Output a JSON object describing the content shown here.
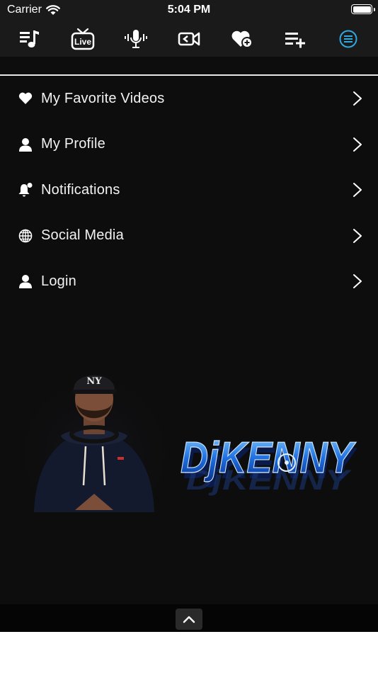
{
  "status_bar": {
    "carrier": "Carrier",
    "time": "5:04 PM",
    "battery_level": 1.0
  },
  "toolbar": {
    "items": [
      {
        "icon": "music-playlist-icon",
        "label": ""
      },
      {
        "icon": "live-tv-icon",
        "label": "Live"
      },
      {
        "icon": "podcast-mic-icon",
        "label": ""
      },
      {
        "icon": "video-camera-icon",
        "label": ""
      },
      {
        "icon": "heart-plus-icon",
        "label": ""
      },
      {
        "icon": "playlist-add-icon",
        "label": ""
      },
      {
        "icon": "menu-icon",
        "label": ""
      }
    ],
    "active_index": 6,
    "active_color": "#2fa8e0"
  },
  "menu": {
    "items": [
      {
        "label": "My Favorite Videos",
        "icon": "heart-icon"
      },
      {
        "label": "My Profile",
        "icon": "person-icon"
      },
      {
        "label": "Notifications",
        "icon": "bell-icon"
      },
      {
        "label": "Social Media",
        "icon": "globe-icon"
      },
      {
        "label": "Login",
        "icon": "person-icon"
      }
    ]
  },
  "banner": {
    "cap_text": "NY",
    "logo_text": "DjKENNY"
  },
  "colors": {
    "background": "#0d0d0d",
    "bar": "#1a1a1a",
    "accent": "#2fa8e0"
  }
}
